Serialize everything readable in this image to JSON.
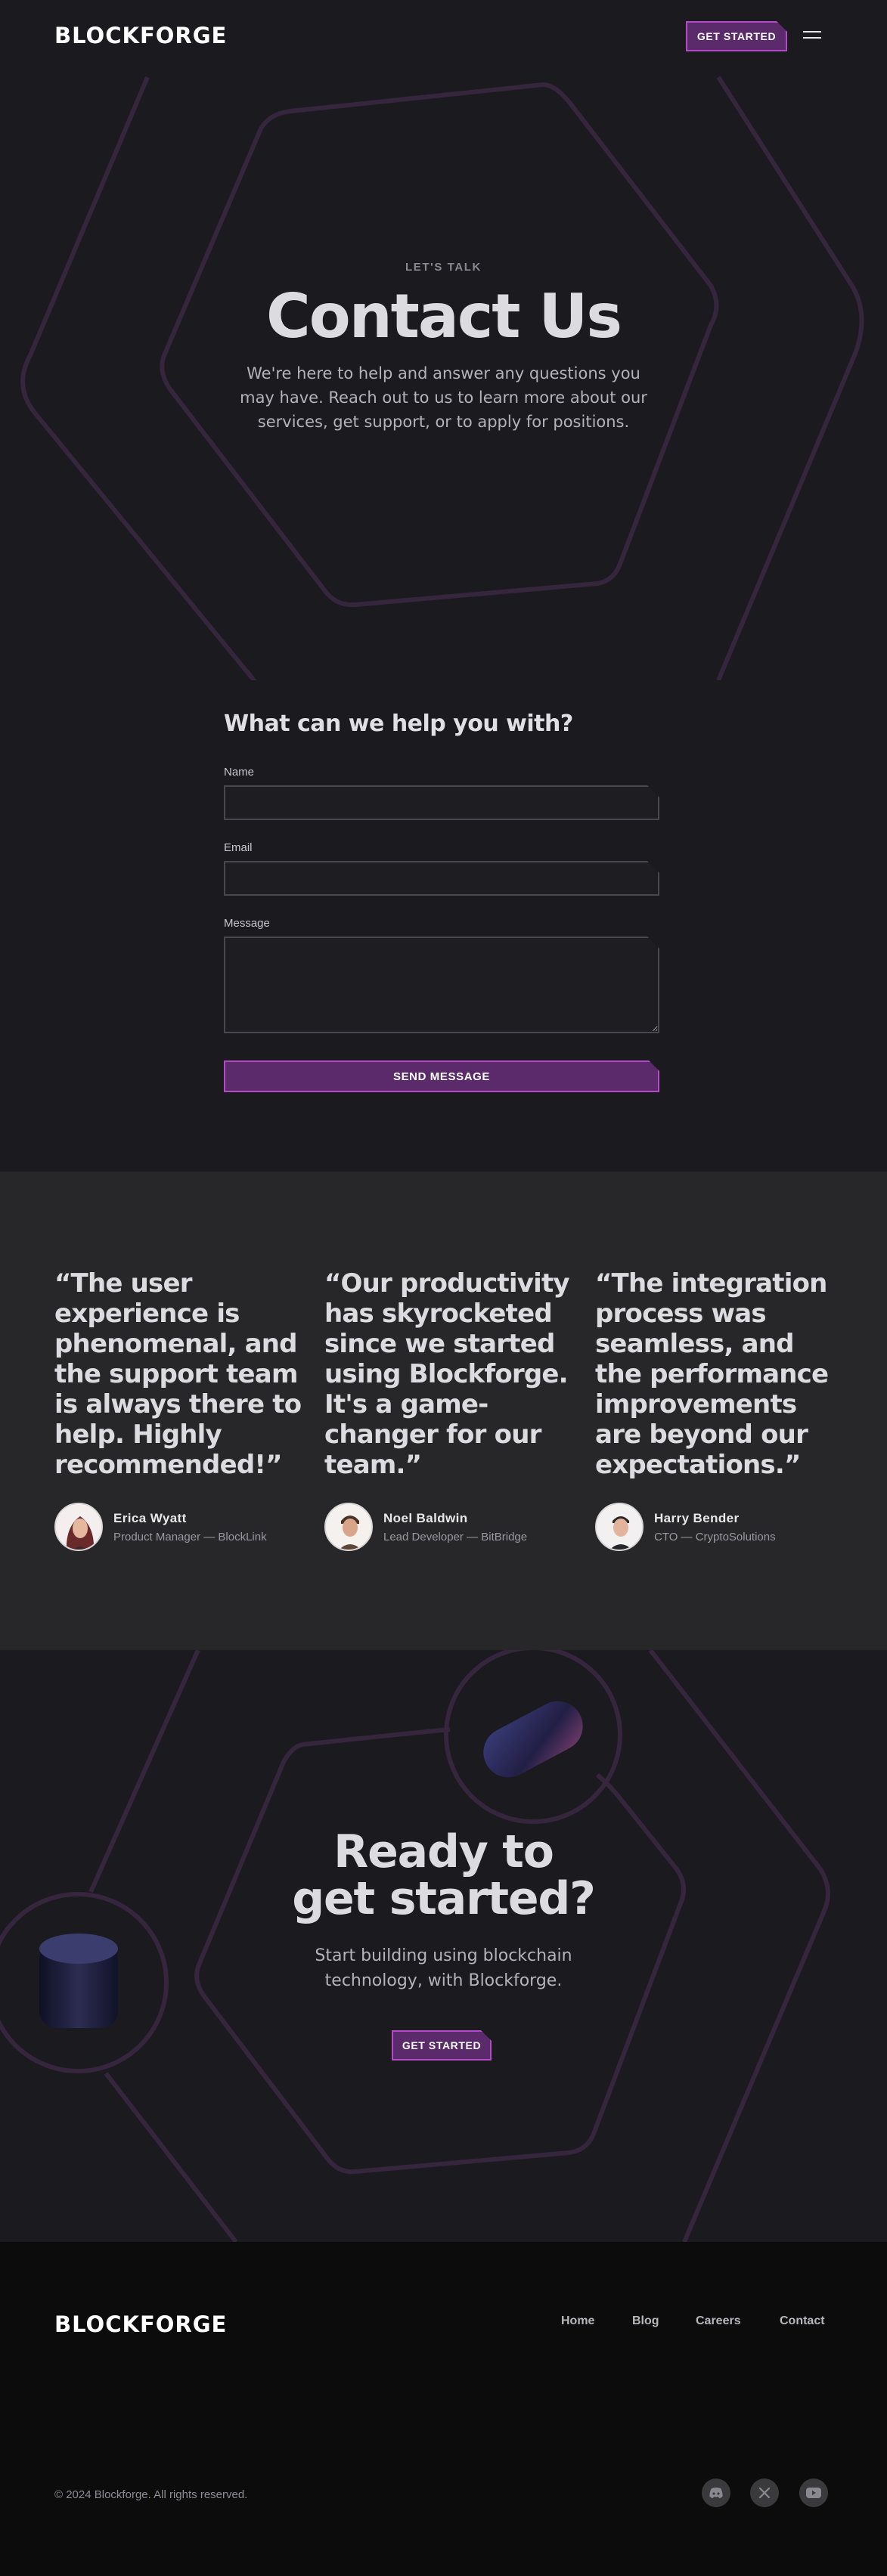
{
  "header": {
    "logo": "BLOCKFORGE",
    "cta_label": "GET STARTED",
    "menu_icon": "hamburger-menu-icon"
  },
  "hero": {
    "eyebrow": "LET'S TALK",
    "title": "Contact Us",
    "text": "We're here to help and answer any questions you may have. Reach out to us to learn more about our services, get support, or to apply for positions."
  },
  "form": {
    "heading": "What can we help you with?",
    "name_label": "Name",
    "name_value": "",
    "email_label": "Email",
    "email_value": "",
    "message_label": "Message",
    "message_value": "",
    "submit_label": "SEND MESSAGE"
  },
  "testimonials": [
    {
      "quote": "“The user experience is phenomenal, and the support team is always there to help. Highly recommended!”",
      "name": "Erica Wyatt",
      "role": "Product Manager — BlockLink"
    },
    {
      "quote": "“Our productivity has skyrocketed since we started using Blockforge. It's a game-changer for our team.”",
      "name": "Noel Baldwin",
      "role": "Lead Developer — BitBridge"
    },
    {
      "quote": "“The integration process was seamless, and the performance improvements are beyond our expectations.”",
      "name": "Harry Bender",
      "role": "CTO — CryptoSolutions"
    }
  ],
  "cta": {
    "title_line1": "Ready to",
    "title_line2": "get started?",
    "text": "Start building using blockchain technology, with Blockforge.",
    "button_label": "GET STARTED"
  },
  "footer": {
    "logo": "BLOCKFORGE",
    "links": [
      "Home",
      "Blog",
      "Careers",
      "Contact"
    ],
    "copyright": "© 2024 Blockforge. All rights reserved.",
    "social_icons": [
      "discord-icon",
      "x-icon",
      "youtube-icon"
    ]
  },
  "colors": {
    "background": "#1b1a1f",
    "surface": "#27272a",
    "footer": "#0c0c0d",
    "accent": "#b44ac9",
    "accent_fill": "#5b2a6a",
    "outline_deco": "#3a2740"
  }
}
